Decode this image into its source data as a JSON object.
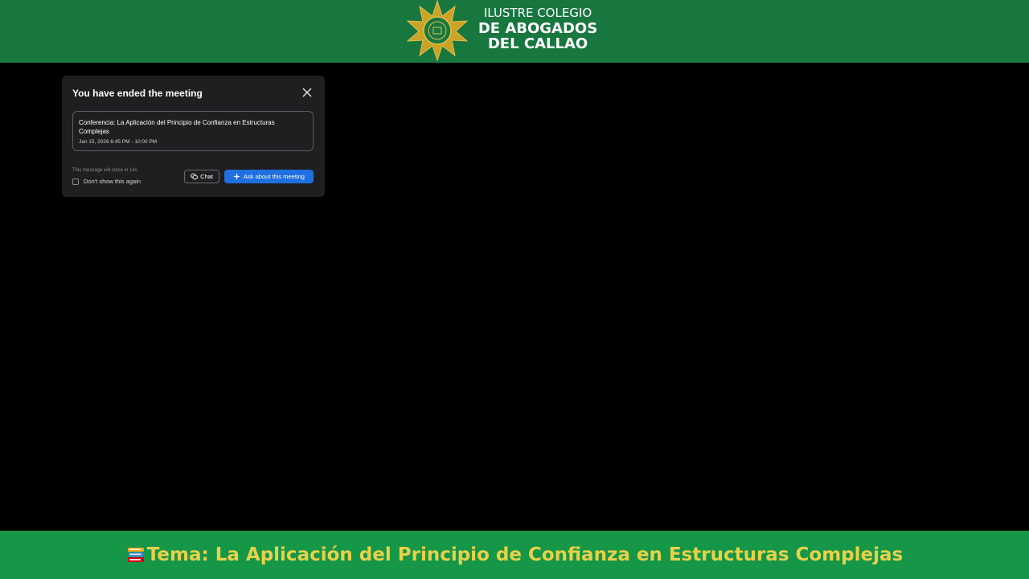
{
  "header": {
    "logo_line1": "ILUSTRE COLEGIO",
    "logo_line2": "DE ABOGADOS",
    "logo_line3": "DEL CALLAO",
    "logo_icon": "star-seal-icon",
    "background_color": "#18763f"
  },
  "dialog": {
    "title": "You have ended the meeting",
    "meeting_title": "Conferencia: La Aplicación del Principio de Confianza en Estructuras Complejas",
    "meeting_time": "Jan 15, 2026 6:45 PM - 10:00 PM",
    "close_note": "This message will close in 14s",
    "dont_show_label": "Don't show this again",
    "chat_label": "Chat",
    "ask_label": "Ask about this meeting",
    "accent_color": "#1f6fe0"
  },
  "footer": {
    "topic": "Tema: La Aplicación del Principio de Confianza en Estructuras Complejas",
    "topic_icon": "books-icon",
    "background_color": "#169647",
    "text_color": "#e8d14a"
  }
}
